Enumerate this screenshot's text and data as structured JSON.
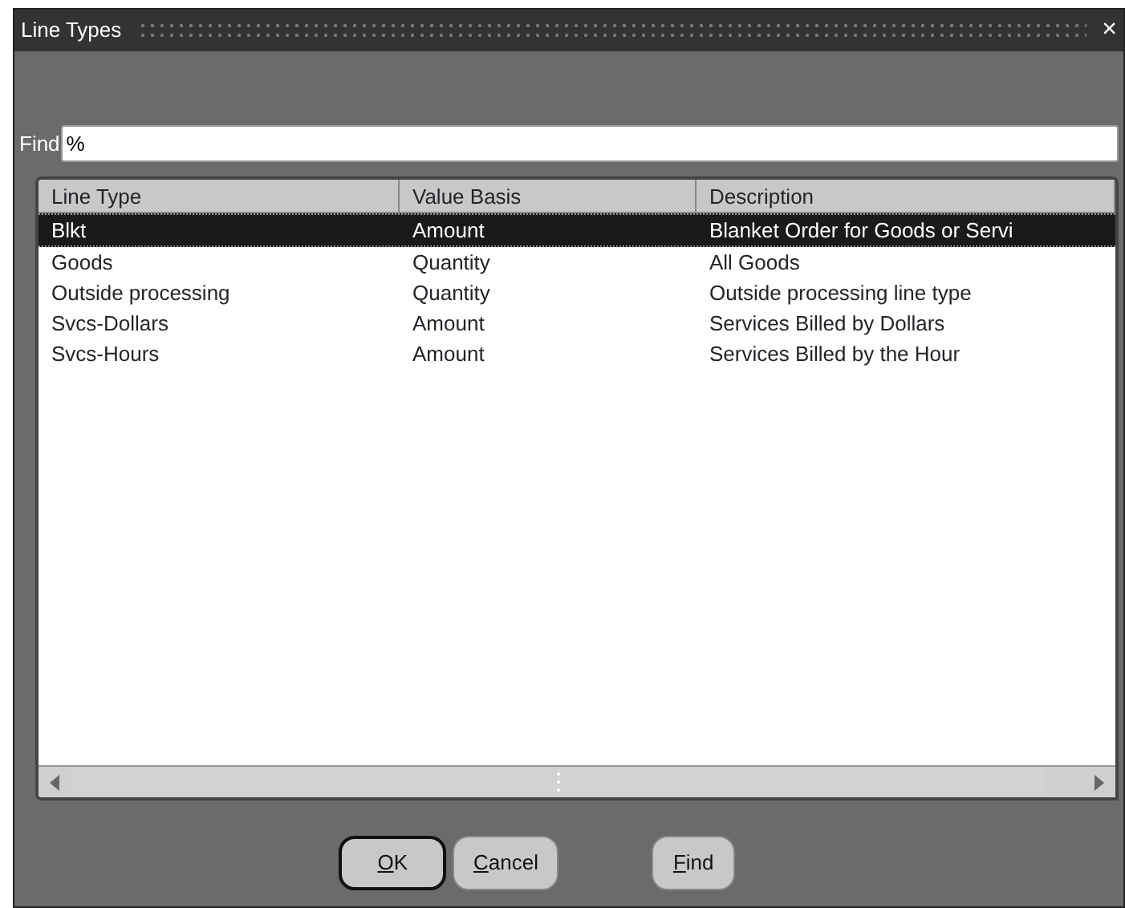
{
  "window": {
    "title": "Line Types",
    "close_glyph": "×"
  },
  "find": {
    "label": "Find",
    "value": "%"
  },
  "table": {
    "columns": [
      "Line Type",
      "Value Basis",
      "Description"
    ],
    "rows": [
      {
        "cells": [
          "Blkt",
          "Amount",
          "Blanket Order for Goods or Servi"
        ],
        "selected": true
      },
      {
        "cells": [
          "Goods",
          "Quantity",
          "All Goods"
        ],
        "selected": false
      },
      {
        "cells": [
          "Outside processing",
          "Quantity",
          "Outside processing line type"
        ],
        "selected": false
      },
      {
        "cells": [
          "Svcs-Dollars",
          "Amount",
          "Services Billed by Dollars"
        ],
        "selected": false
      },
      {
        "cells": [
          "Svcs-Hours",
          "Amount",
          "Services Billed by the Hour"
        ],
        "selected": false
      }
    ]
  },
  "buttons": [
    {
      "label": "OK",
      "default": true,
      "underline_first": true
    },
    {
      "label": "Cancel",
      "default": false,
      "underline_first": true
    },
    {
      "label": "Find",
      "default": false,
      "underline_first": true
    }
  ]
}
